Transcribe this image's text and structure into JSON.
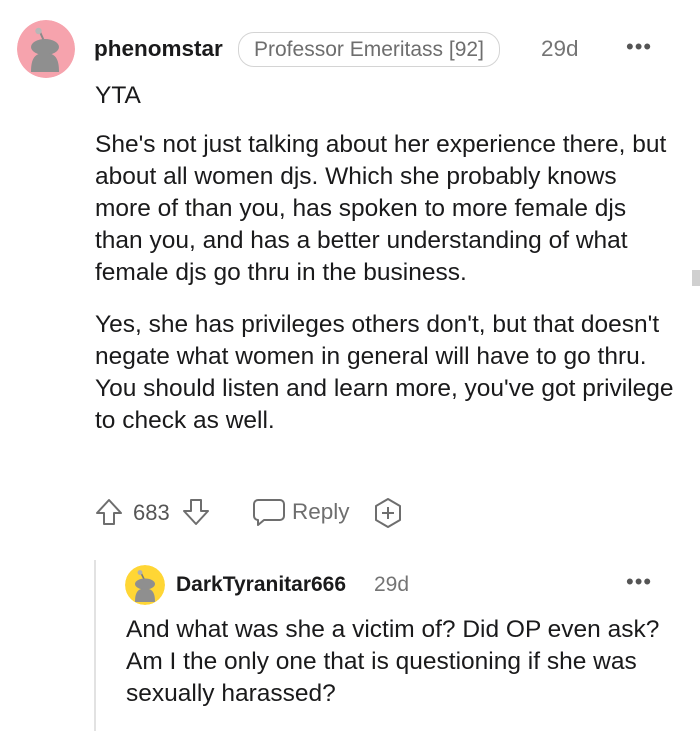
{
  "comment": {
    "username": "phenomstar",
    "flair": "Professor Emeritass [92]",
    "age": "29d",
    "more_icon": "more-horizontal-icon",
    "verdict": "YTA",
    "paragraphs": [
      "She's not just talking about her experience there, but about all women djs. Which she probably knows more of than you, has spoken to more female djs than you, and has a better understanding of what female djs go thru in the business.",
      "Yes, she has privileges others don't, but that doesn't negate what women in general will have to go thru. You should listen and learn more, you've got privilege to check as well."
    ],
    "score": "683",
    "reply_label": "Reply",
    "avatar_color": "#f6a3ad"
  },
  "reply": {
    "username": "DarkTyranitar666",
    "age": "29d",
    "text": "And what was she a victim of? Did OP even ask? Am I the only one that is questioning if she was sexually harassed?",
    "avatar_color": "#ffd635"
  }
}
